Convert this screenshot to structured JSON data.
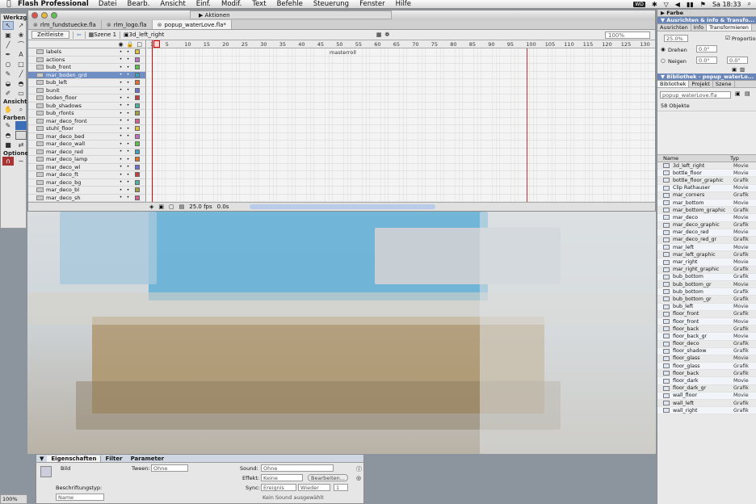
{
  "menubar": {
    "app_name": "Flash Professional",
    "items": [
      "Datei",
      "Bearb.",
      "Ansicht",
      "Einf.",
      "Modif.",
      "Text",
      "Befehle",
      "Steuerung",
      "Fenster",
      "Hilfe"
    ],
    "clock": "Sa 18:33"
  },
  "toolbox": {
    "title": "Werkzg",
    "view_label": "Ansicht",
    "colors_label": "Farben",
    "options_label": "Optionen"
  },
  "window": {
    "actions_label": "Aktionen",
    "tabs": [
      {
        "label": "rlm_fundstuecke.fla"
      },
      {
        "label": "rlm_logo.fla"
      },
      {
        "label": "popup_waterLove.fla*"
      }
    ],
    "edit": {
      "timeline_button": "Zeitleiste",
      "scene": "Szene 1",
      "symbol": "3d_left_right",
      "zoom": "100%"
    }
  },
  "timeline": {
    "ruler": [
      "1",
      "5",
      "10",
      "15",
      "20",
      "25",
      "30",
      "35",
      "40",
      "45",
      "50",
      "55",
      "60",
      "65",
      "70",
      "75",
      "80",
      "85",
      "90",
      "95",
      "100",
      "105",
      "110",
      "115",
      "120",
      "125",
      "130"
    ],
    "frame_label": "masterroll",
    "layers": [
      "labels",
      "actions",
      "bub_front",
      "mar_boden_grd",
      "bub_left",
      "bunit",
      "boden_floor",
      "bub_shadows",
      "bub_rfonts",
      "mar_deco_front",
      "stuhl_floor",
      "mar_deco_bed",
      "mar_deco_wall",
      "mar_deco_red",
      "mar_deco_lamp",
      "mar_deco_wl",
      "mar_deco_ft",
      "mar_deco_bg",
      "mar_deco_bl",
      "mar_deco_sh"
    ],
    "fps": "25.0 fps",
    "time": "0.0s"
  },
  "properties": {
    "tabs": [
      "Eigenschaften",
      "Filter",
      "Parameter"
    ],
    "instance_label": "Bild",
    "tween_label": "Tween:",
    "tween_value": "Ohne",
    "sound_label": "Sound:",
    "sound_value": "Ohne",
    "effect_label": "Effekt:",
    "effect_value": "Keine",
    "edit_button": "Bearbeiten...",
    "sync_label": "Sync:",
    "sync_value": "Ereignis",
    "repeat_value": "Wieder",
    "repeat_count": "1",
    "label_type_label": "Beschriftungstyp:",
    "label_type_value": "Name",
    "no_sound": "Kein Sound ausgewählt"
  },
  "right_panel": {
    "color_header": "Farbe",
    "align_header": "Ausrichten & Info & Transfo...",
    "align_tabs": [
      "Ausrichten",
      "Info",
      "Transformieren"
    ],
    "width_value": "25.0%",
    "proportions_label": "Proportionen",
    "rotate_label": "Drehen",
    "rotate_value": "0.0°",
    "skew_label": "Neigen",
    "skew_value": "0.0°",
    "library_header": "Bibliothek - popup_waterLo...",
    "library_tabs": [
      "Bibliothek",
      "Projekt",
      "Szene"
    ],
    "library_file": "popup_waterLove.fla",
    "object_count": "58 Objekte",
    "columns": {
      "name": "Name",
      "type": "Typ"
    },
    "items": [
      {
        "name": "3d_left_right",
        "type": "Movie"
      },
      {
        "name": "bottle_floor",
        "type": "Movie"
      },
      {
        "name": "bottle_floor_graphic",
        "type": "Grafik"
      },
      {
        "name": "Clip Rathauser",
        "type": "Movie"
      },
      {
        "name": "mar_corners",
        "type": "Grafik"
      },
      {
        "name": "mar_bottom",
        "type": "Movie"
      },
      {
        "name": "mar_bottom_graphic",
        "type": "Grafik"
      },
      {
        "name": "mar_deco",
        "type": "Movie"
      },
      {
        "name": "mar_deco_graphic",
        "type": "Grafik"
      },
      {
        "name": "mar_deco_red",
        "type": "Movie"
      },
      {
        "name": "mar_deco_red_gr",
        "type": "Grafik"
      },
      {
        "name": "mar_left",
        "type": "Movie"
      },
      {
        "name": "mar_left_graphic",
        "type": "Grafik"
      },
      {
        "name": "mar_right",
        "type": "Movie"
      },
      {
        "name": "mar_right_graphic",
        "type": "Grafik"
      },
      {
        "name": "bub_bottom",
        "type": "Grafik"
      },
      {
        "name": "bub_bottom_gr",
        "type": "Movie"
      },
      {
        "name": "bub_bottom",
        "type": "Grafik"
      },
      {
        "name": "bub_bottom_gr",
        "type": "Grafik"
      },
      {
        "name": "bub_left",
        "type": "Movie"
      },
      {
        "name": "floor_front",
        "type": "Grafik"
      },
      {
        "name": "floor_front",
        "type": "Movie"
      },
      {
        "name": "floor_back",
        "type": "Grafik"
      },
      {
        "name": "floor_back_gr",
        "type": "Movie"
      },
      {
        "name": "floor_deco",
        "type": "Grafik"
      },
      {
        "name": "floor_shadow",
        "type": "Grafik"
      },
      {
        "name": "floor_glass",
        "type": "Movie"
      },
      {
        "name": "floor_glass",
        "type": "Grafik"
      },
      {
        "name": "floor_back",
        "type": "Grafik"
      },
      {
        "name": "floor_dark",
        "type": "Movie"
      },
      {
        "name": "floor_dark_gr",
        "type": "Grafik"
      },
      {
        "name": "wall_floor",
        "type": "Movie"
      },
      {
        "name": "wall_left",
        "type": "Grafik"
      },
      {
        "name": "wall_right",
        "type": "Grafik"
      }
    ]
  },
  "status_zoom": "100%"
}
